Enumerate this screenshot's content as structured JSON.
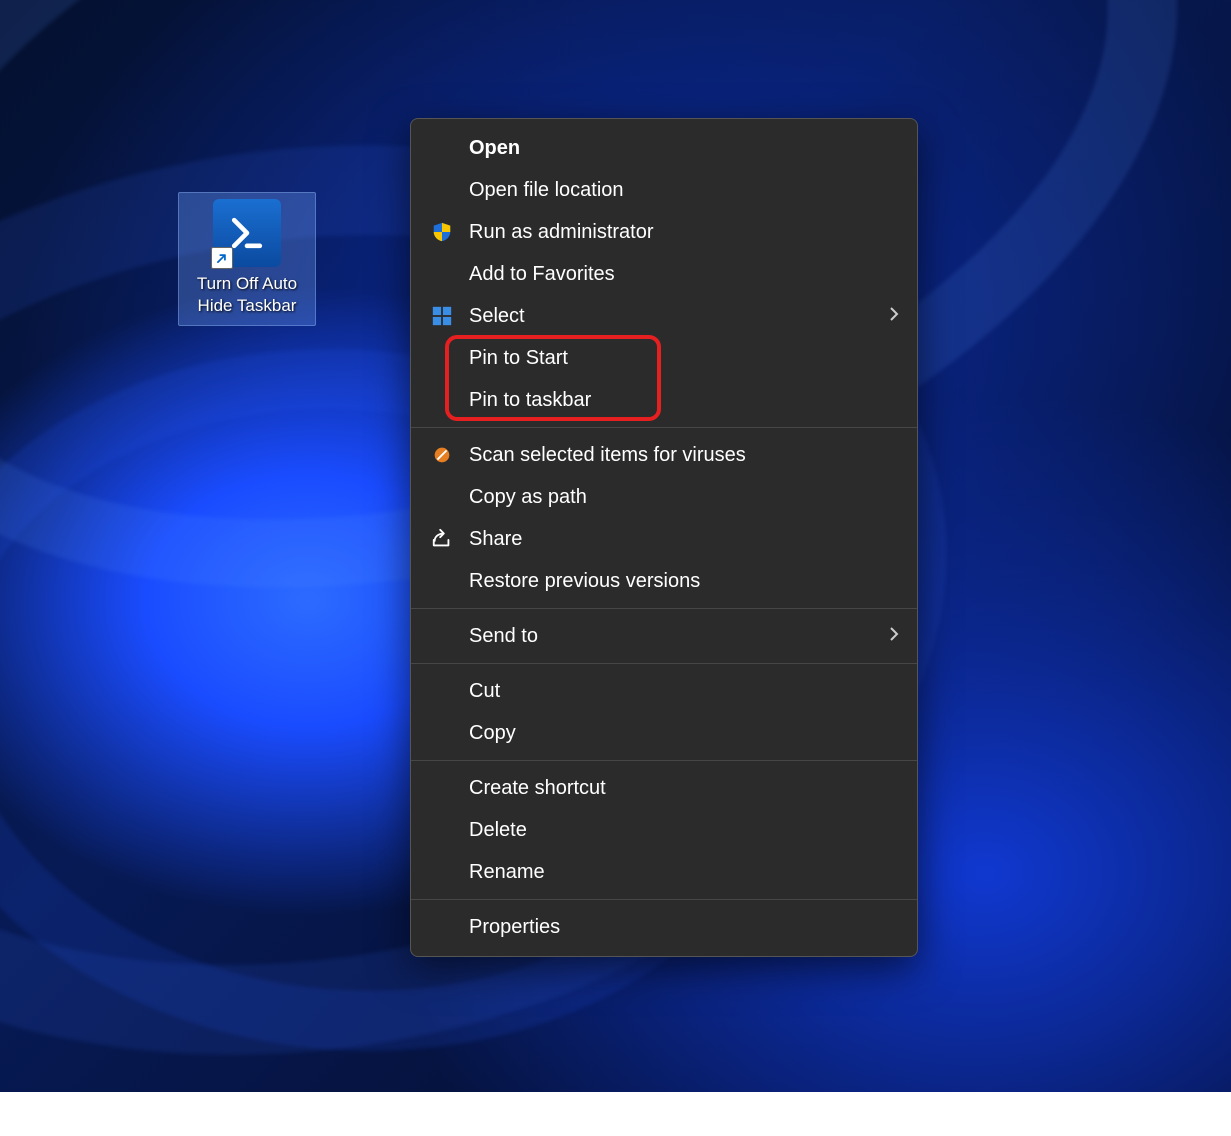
{
  "desktop": {
    "shortcut_label": "Turn Off Auto Hide Taskbar"
  },
  "context_menu": {
    "open": "Open",
    "open_file_location": "Open file location",
    "run_as_admin": "Run as administrator",
    "add_to_favorites": "Add to Favorites",
    "select": "Select",
    "pin_to_start": "Pin to Start",
    "pin_to_taskbar": "Pin to taskbar",
    "scan_viruses": "Scan selected items for viruses",
    "copy_as_path": "Copy as path",
    "share": "Share",
    "restore_versions": "Restore previous versions",
    "send_to": "Send to",
    "cut": "Cut",
    "copy": "Copy",
    "create_shortcut": "Create shortcut",
    "delete": "Delete",
    "rename": "Rename",
    "properties": "Properties"
  }
}
